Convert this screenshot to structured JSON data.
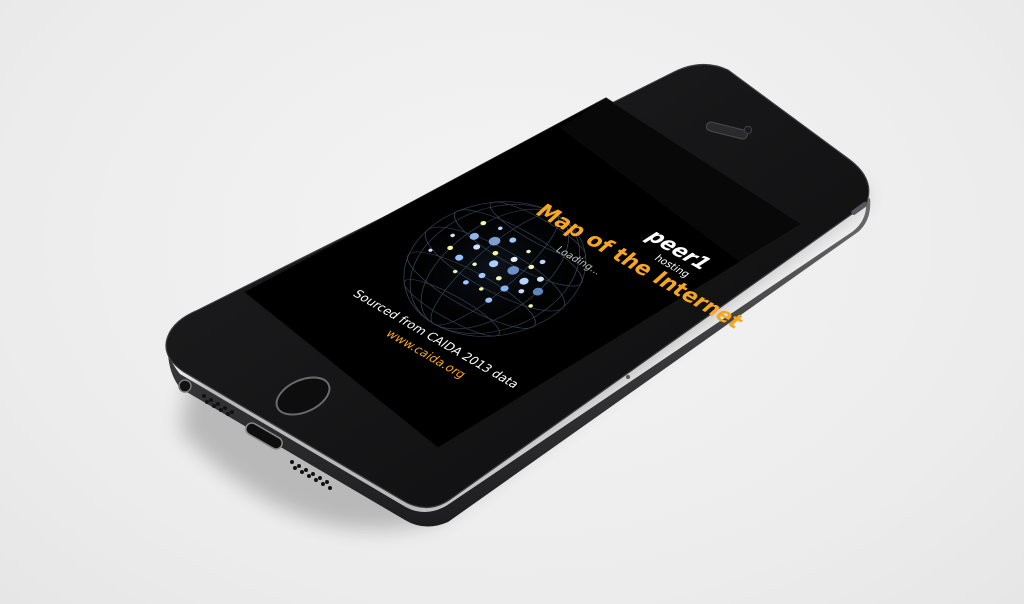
{
  "device": {
    "model": "smartphone",
    "finish_color": "#2b2b2d",
    "screen_color": "#000000"
  },
  "app": {
    "brand": "peer1",
    "brand_sub": "hosting",
    "title": "Map of the Internet",
    "status": "Loading...",
    "source_line": "Sourced from CAIDA 2013 data",
    "source_link": "www.caida.org",
    "accent_color": "#f5a623",
    "text_color": "#ffffff"
  },
  "icons": {
    "globe": "globe-map-icon",
    "home": "home-button-icon"
  }
}
